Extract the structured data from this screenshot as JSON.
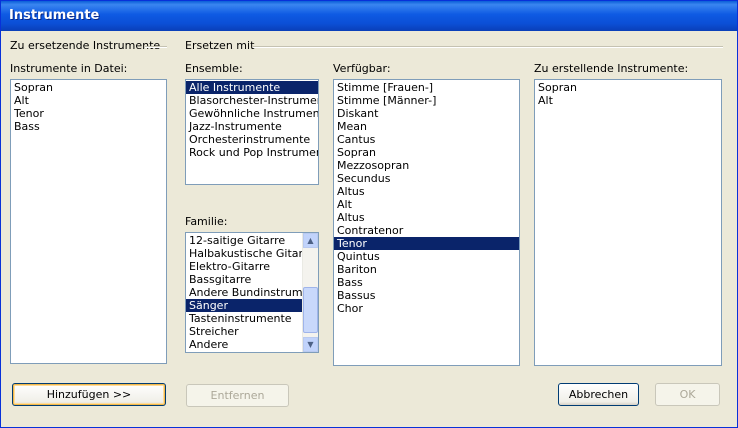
{
  "window": {
    "title": "Instrumente"
  },
  "left_group": {
    "title": "Zu ersetzende Instrumente",
    "file_label": "Instrumente in Datei:",
    "items": [
      "Sopran",
      "Alt",
      "Tenor",
      "Bass"
    ]
  },
  "right_group": {
    "title": "Ersetzen mit",
    "ensemble": {
      "label": "Ensemble:",
      "items": [
        "Alle Instrumente",
        "Blasorchester-Instrumente",
        "Gewöhnliche Instrumente",
        "Jazz-Instrumente",
        "Orchesterinstrumente",
        "Rock und Pop Instrumente"
      ],
      "selected_index": 0
    },
    "familie": {
      "label": "Familie:",
      "items": [
        "12-saitige Gitarre",
        "Halbakustische Gitarre",
        "Elektro-Gitarre",
        "Bassgitarre",
        "Andere Bundinstrument",
        "Sänger",
        "Tasteninstrumente",
        "Streicher",
        "Andere"
      ],
      "selected_index": 5
    },
    "verfuegbar": {
      "label": "Verfügbar:",
      "items": [
        "Stimme [Frauen-]",
        "Stimme [Männer-]",
        "Diskant",
        "Mean",
        "Cantus",
        "Sopran",
        "Mezzosopran",
        "Secundus",
        "Altus",
        "Alt",
        "Altus",
        "Contratenor",
        "Tenor",
        "Quintus",
        "Bariton",
        "Bass",
        "Bassus",
        "Chor"
      ],
      "selected_index": 12
    },
    "zu_erstellende": {
      "label": "Zu erstellende Instrumente:",
      "items": [
        "Sopran",
        "Alt"
      ]
    }
  },
  "buttons": {
    "add": "Hinzufügen >>",
    "remove": "Entfernen",
    "cancel": "Abbrechen",
    "ok": "OK"
  }
}
